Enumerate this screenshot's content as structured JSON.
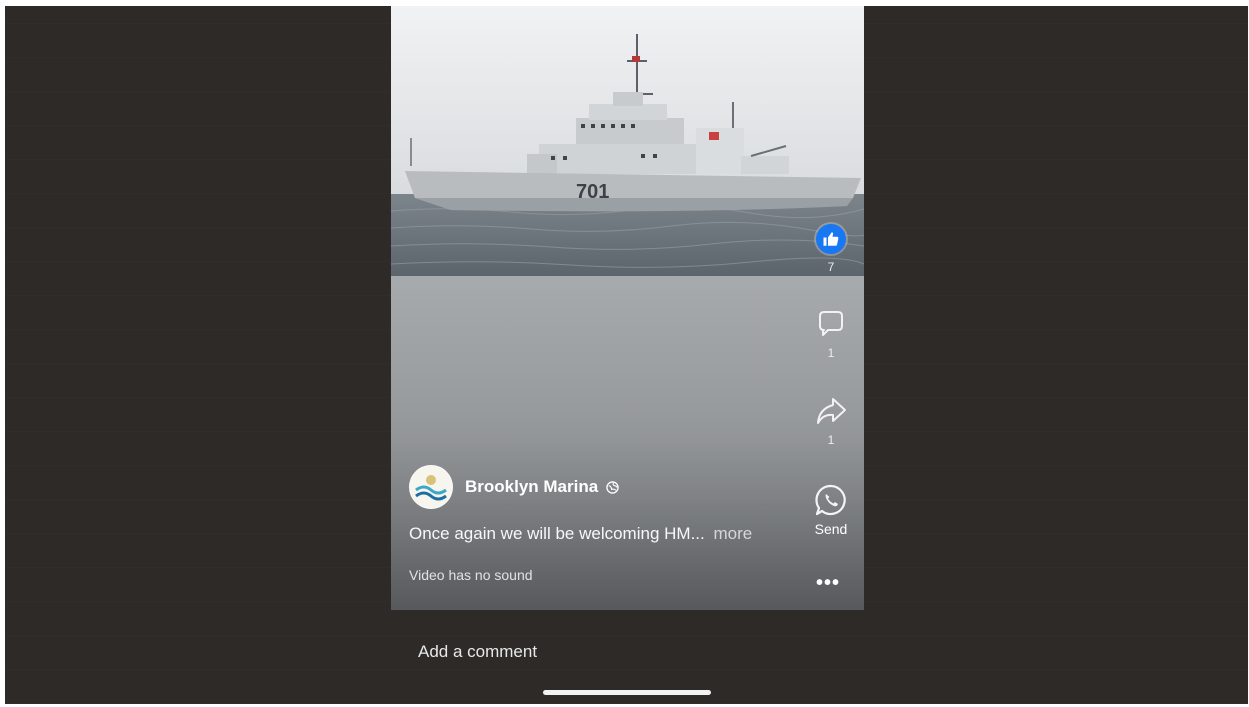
{
  "post": {
    "author": "Brooklyn Marina",
    "caption": "Once again we will be welcoming HM...",
    "more_label": "more",
    "sound_notice": "Video has no sound",
    "hull_number": "701"
  },
  "actions": {
    "like_count": "7",
    "comment_count": "1",
    "share_count": "1",
    "send_label": "Send"
  },
  "comment_bar": {
    "placeholder": "Add a comment"
  },
  "colors": {
    "like_blue": "#1877f2",
    "background": "#2d2a28"
  },
  "icons": [
    "like-icon",
    "comment-icon",
    "share-icon",
    "whatsapp-icon",
    "more-options-icon",
    "globe-icon"
  ]
}
